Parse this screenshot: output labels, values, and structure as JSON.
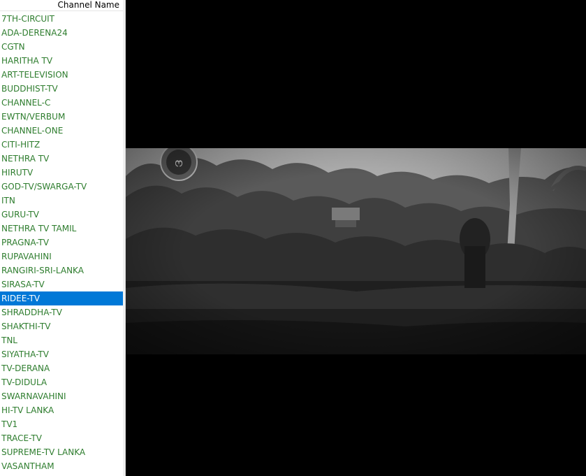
{
  "sidebar": {
    "column_header": "Channel Name",
    "selected_index": 20,
    "channels": [
      "7TH-CIRCUIT",
      "ADA-DERENA24",
      "CGTN",
      "HARITHA TV",
      "ART-TELEVISION",
      "BUDDHIST-TV",
      "CHANNEL-C",
      "EWTN/VERBUM",
      "CHANNEL-ONE",
      "CITI-HITZ",
      "NETHRA TV",
      "HIRUTV",
      "GOD-TV/SWARGA-TV",
      "ITN",
      "GURU-TV",
      "NETHRA TV TAMIL",
      "PRAGNA-TV",
      "RUPAVAHINI",
      "RANGIRI-SRI-LANKA",
      "SIRASA-TV",
      "RIDEE-TV",
      "SHRADDHA-TV",
      "SHAKTHI-TV",
      "TNL",
      "SIYATHA-TV",
      "TV-DERANA",
      "TV-DIDULA",
      "SWARNAVAHINI",
      "HI-TV LANKA",
      "TV1",
      "TRACE-TV",
      "SUPREME-TV LANKA",
      "VASANTHAM"
    ]
  },
  "colors": {
    "channel_text": "#2e7d2e",
    "selected_bg": "#0078d7",
    "selected_text": "#ffffff",
    "player_bg": "#000000"
  },
  "video": {
    "channel_logo_icon": "channel-logo-icon"
  }
}
